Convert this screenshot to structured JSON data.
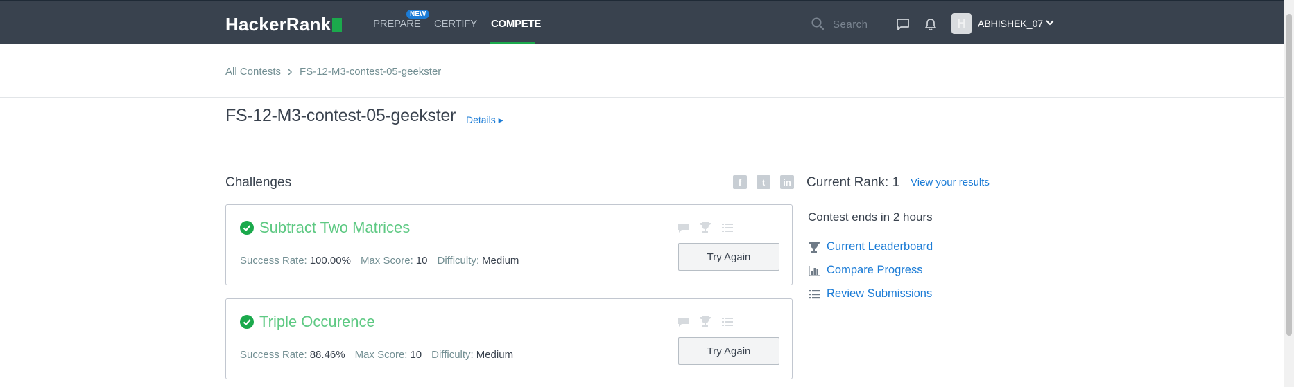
{
  "header": {
    "logo": "HackerRank",
    "nav": [
      {
        "label": "PREPARE",
        "badge": "NEW"
      },
      {
        "label": "CERTIFY"
      },
      {
        "label": "COMPETE"
      }
    ],
    "search_placeholder": "Search",
    "username": "ABHISHEK_07",
    "avatar_letter": "H"
  },
  "breadcrumb": {
    "root": "All Contests",
    "current": "FS-12-M3-contest-05-geekster"
  },
  "page": {
    "title": "FS-12-M3-contest-05-geekster",
    "details_link": "Details ▸"
  },
  "challenges": {
    "heading": "Challenges",
    "items": [
      {
        "title": "Subtract Two Matrices",
        "success_label": "Success Rate:",
        "success_value": "100.00%",
        "max_label": "Max Score:",
        "max_value": "10",
        "difficulty_label": "Difficulty:",
        "difficulty_value": "Medium",
        "button": "Try Again"
      },
      {
        "title": "Triple Occurence",
        "success_label": "Success Rate:",
        "success_value": "88.46%",
        "max_label": "Max Score:",
        "max_value": "10",
        "difficulty_label": "Difficulty:",
        "difficulty_value": "Medium",
        "button": "Try Again"
      }
    ]
  },
  "sidebar": {
    "rank_text": "Current Rank: 1",
    "view_results": "View your results",
    "ends_prefix": "Contest ends in",
    "ends_time": "2 hours",
    "links": [
      "Current Leaderboard",
      "Compare Progress",
      "Review Submissions"
    ]
  },
  "colors": {
    "navbar": "#39424e",
    "accent_green": "#1ba94c",
    "link_blue": "#1c7cd6",
    "solved_green": "#5ec983"
  },
  "icons": [
    "search-icon",
    "chat-icon",
    "bell-icon",
    "chevron-down-icon",
    "facebook-icon",
    "twitter-icon",
    "linkedin-icon",
    "check-circle-icon",
    "comment-icon",
    "trophy-icon",
    "list-icon",
    "bar-chart-icon"
  ]
}
